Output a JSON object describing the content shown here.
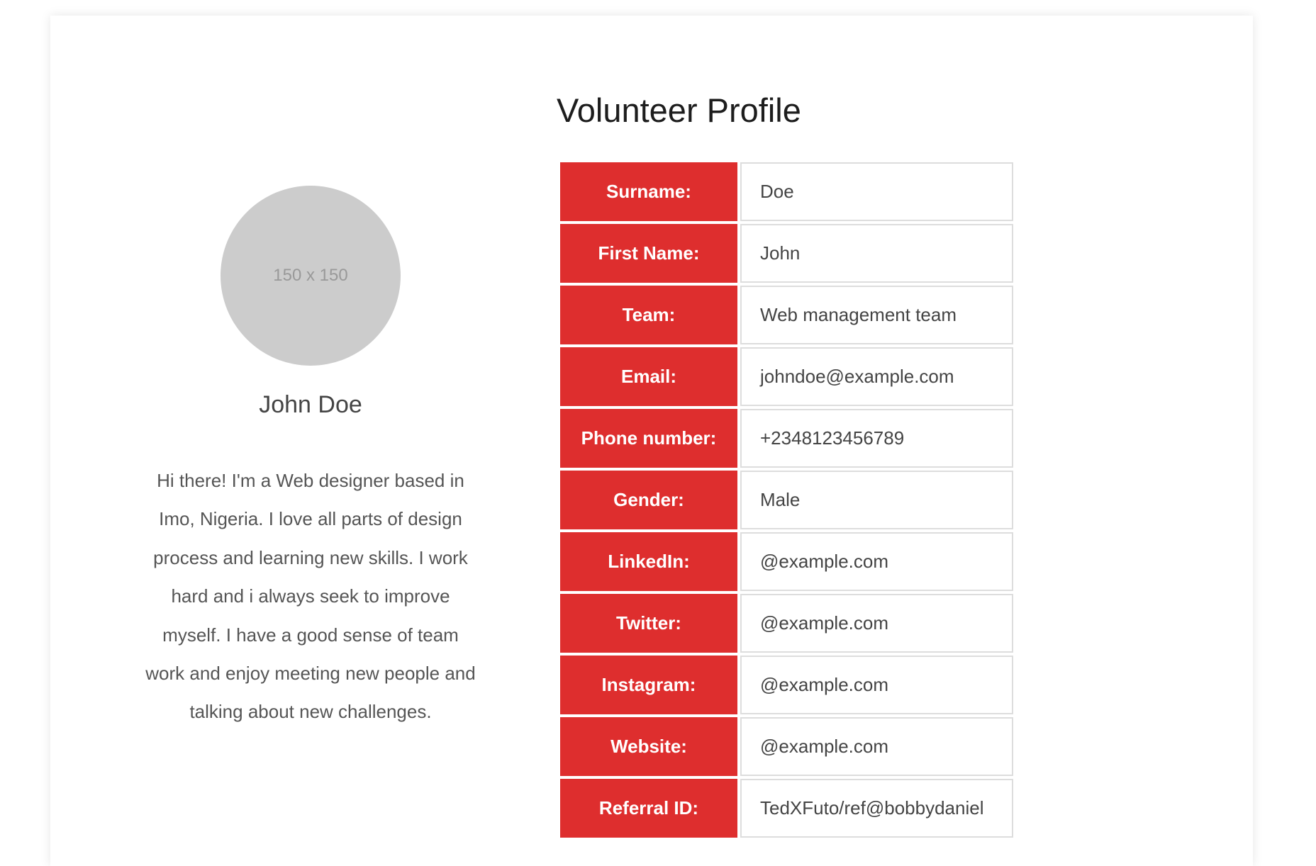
{
  "page": {
    "title": "Volunteer Profile"
  },
  "profile": {
    "avatar_placeholder": "150 x 150",
    "name": "John Doe",
    "bio": "Hi there! I'm a Web designer based in Imo, Nigeria. I love all parts of design process and learning new skills. I work hard and i always seek to improve myself. I have a good sense of team work and enjoy meeting new people and talking about new challenges."
  },
  "details": {
    "rows": [
      {
        "label": "Surname:",
        "value": "Doe"
      },
      {
        "label": "First Name:",
        "value": "John"
      },
      {
        "label": "Team:",
        "value": "Web management team"
      },
      {
        "label": "Email:",
        "value": "johndoe@example.com"
      },
      {
        "label": "Phone number:",
        "value": "+2348123456789"
      },
      {
        "label": "Gender:",
        "value": "Male"
      },
      {
        "label": "LinkedIn:",
        "value": "@example.com"
      },
      {
        "label": "Twitter:",
        "value": "@example.com"
      },
      {
        "label": "Instagram:",
        "value": "@example.com"
      },
      {
        "label": "Website:",
        "value": "@example.com"
      },
      {
        "label": "Referral ID:",
        "value": "TedXFuto/ref@bobbydaniel"
      }
    ]
  },
  "colors": {
    "label_background": "#de2e2e",
    "label_text": "#ffffff",
    "avatar_background": "#cccccc"
  }
}
